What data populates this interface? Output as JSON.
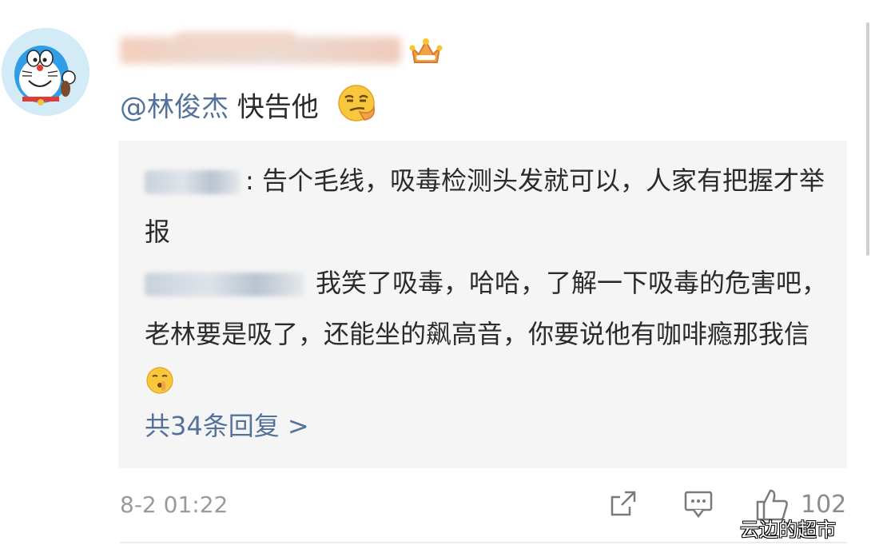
{
  "comment": {
    "mention": "@林俊杰",
    "text": " 快告他",
    "emoji": "smirk-emoji"
  },
  "replies": [
    {
      "text": ": 告个毛线，吸毒检测头发就可以，人家有把握才举报"
    },
    {
      "text": "我笑了吸毒，哈哈，了解一下吸毒的危害吧，老林要是吸了，还能坐的飙高音，你要说他有咖啡瘾那我信",
      "emoji": "shush-emoji"
    }
  ],
  "more_replies": "共34条回复 >",
  "footer": {
    "time": "8-2 01:22",
    "like_count": "102",
    "icons": [
      "share-icon",
      "comment-icon",
      "like-icon"
    ]
  },
  "watermark": "云边的超市",
  "colors": {
    "link": "#54719b",
    "reply_bg": "#f5f5f5",
    "meta": "#9a9a9a"
  }
}
